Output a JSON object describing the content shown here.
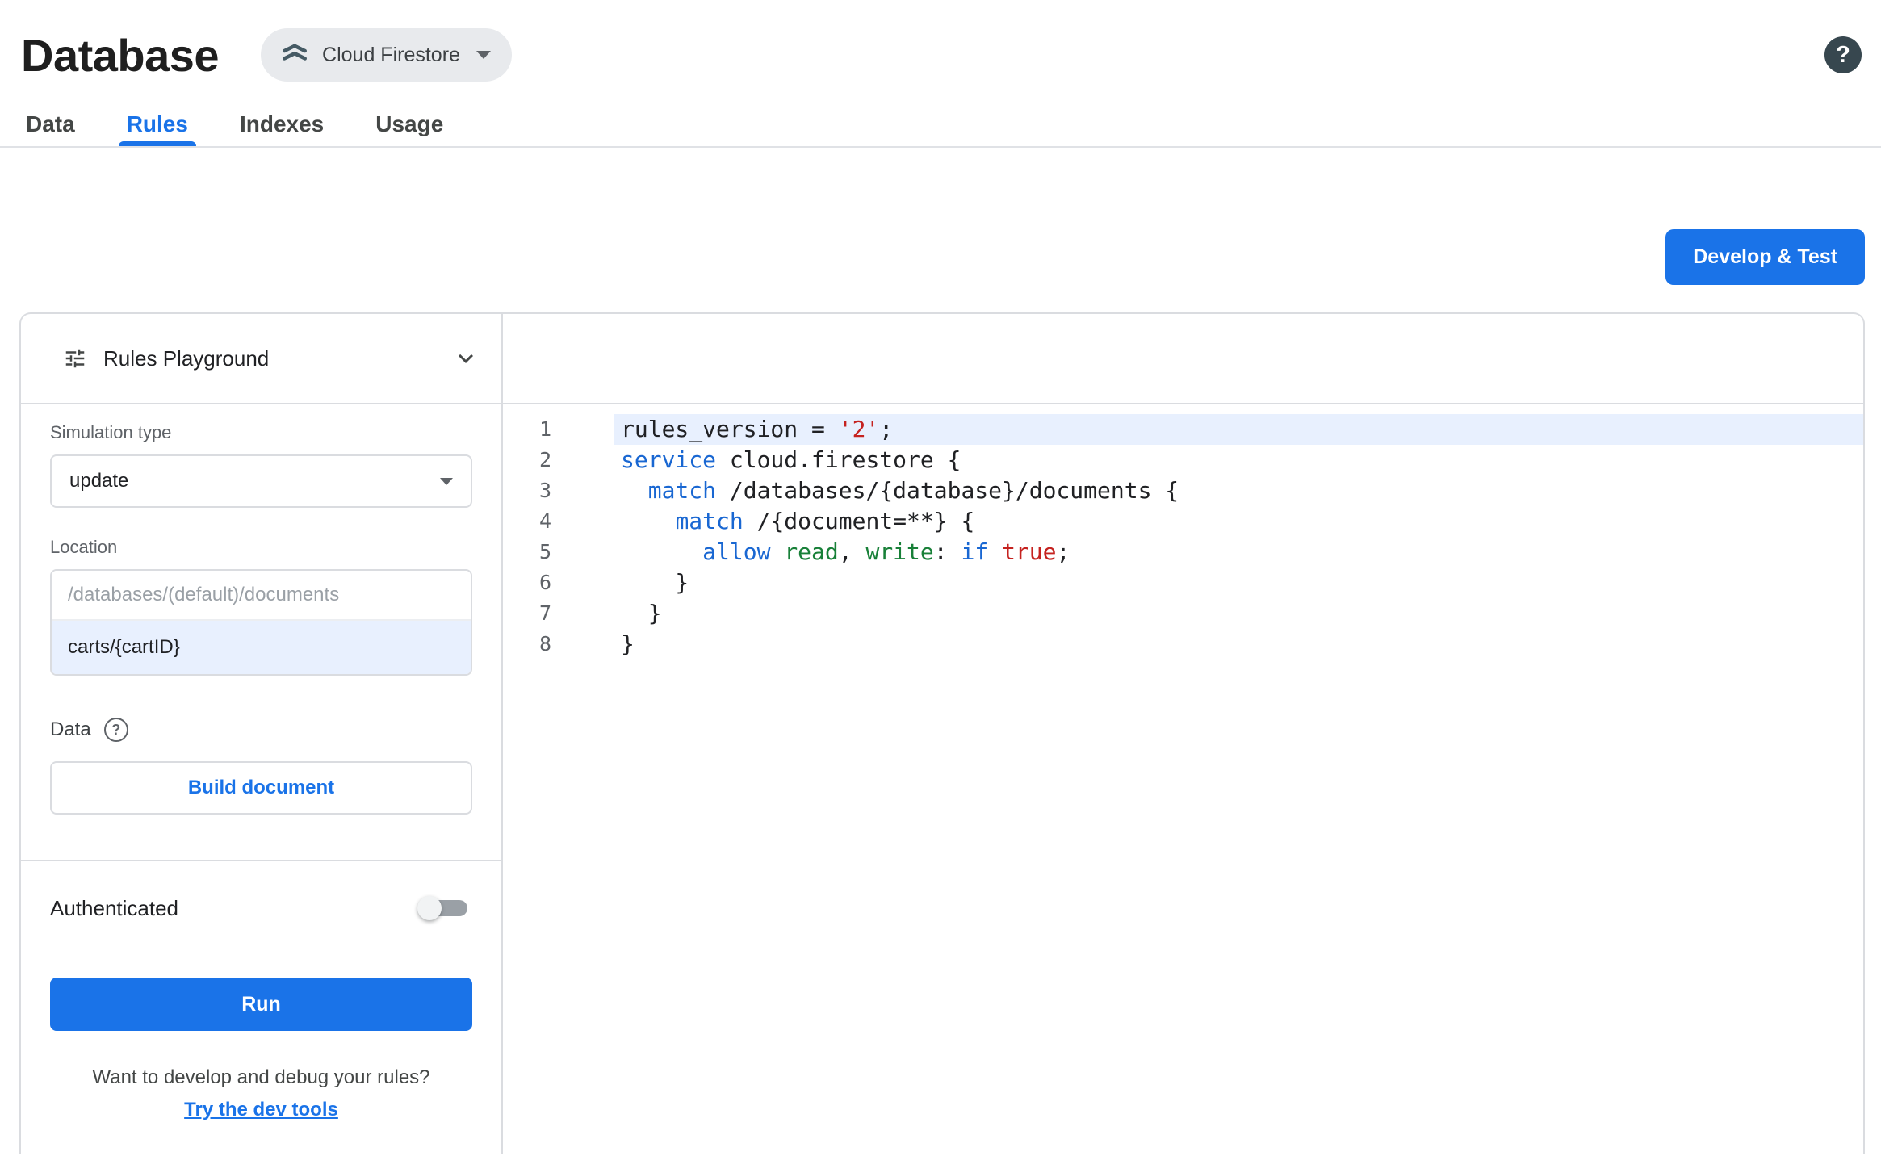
{
  "header": {
    "title": "Database",
    "product_chip": {
      "label": "Cloud Firestore"
    },
    "help_glyph": "?"
  },
  "tabs": [
    {
      "label": "Data",
      "active": false
    },
    {
      "label": "Rules",
      "active": true
    },
    {
      "label": "Indexes",
      "active": false
    },
    {
      "label": "Usage",
      "active": false
    }
  ],
  "actions": {
    "develop_test_label": "Develop & Test"
  },
  "playground": {
    "title": "Rules Playground",
    "simulation_type": {
      "label": "Simulation type",
      "value": "update"
    },
    "location": {
      "label": "Location",
      "placeholder": "/databases/(default)/documents",
      "value": "carts/{cartID}"
    },
    "data_section": {
      "label": "Data",
      "help_glyph": "?",
      "build_button": "Build document"
    },
    "authenticated": {
      "label": "Authenticated",
      "enabled": false
    },
    "run_button": "Run",
    "footer": {
      "text": "Want to develop and debug your rules?",
      "link": "Try the dev tools"
    }
  },
  "editor": {
    "lines": [
      {
        "number": 1,
        "highlighted": true,
        "tokens": [
          {
            "type": "plain",
            "text": "rules_version = "
          },
          {
            "type": "string",
            "text": "'2'"
          },
          {
            "type": "plain",
            "text": ";"
          }
        ]
      },
      {
        "number": 2,
        "highlighted": false,
        "tokens": [
          {
            "type": "keyword",
            "text": "service"
          },
          {
            "type": "plain",
            "text": " cloud.firestore {"
          }
        ]
      },
      {
        "number": 3,
        "highlighted": false,
        "tokens": [
          {
            "type": "plain",
            "text": "  "
          },
          {
            "type": "keyword",
            "text": "match"
          },
          {
            "type": "plain",
            "text": " /databases/{database}/documents {"
          }
        ]
      },
      {
        "number": 4,
        "highlighted": false,
        "tokens": [
          {
            "type": "plain",
            "text": "    "
          },
          {
            "type": "keyword",
            "text": "match"
          },
          {
            "type": "plain",
            "text": " /{document=**} {"
          }
        ]
      },
      {
        "number": 5,
        "highlighted": false,
        "tokens": [
          {
            "type": "plain",
            "text": "      "
          },
          {
            "type": "keyword",
            "text": "allow"
          },
          {
            "type": "plain",
            "text": " "
          },
          {
            "type": "builtin",
            "text": "read"
          },
          {
            "type": "plain",
            "text": ", "
          },
          {
            "type": "builtin",
            "text": "write"
          },
          {
            "type": "plain",
            "text": ": "
          },
          {
            "type": "keyword",
            "text": "if"
          },
          {
            "type": "plain",
            "text": " "
          },
          {
            "type": "string",
            "text": "true"
          },
          {
            "type": "plain",
            "text": ";"
          }
        ]
      },
      {
        "number": 6,
        "highlighted": false,
        "tokens": [
          {
            "type": "plain",
            "text": "    }"
          }
        ]
      },
      {
        "number": 7,
        "highlighted": false,
        "tokens": [
          {
            "type": "plain",
            "text": "  }"
          }
        ]
      },
      {
        "number": 8,
        "highlighted": false,
        "tokens": [
          {
            "type": "plain",
            "text": "}"
          }
        ]
      }
    ]
  },
  "colors": {
    "accent": "#1a73e8",
    "keyword": "#1967d2",
    "string": "#c5221f",
    "builtin": "#188038",
    "line_highlight": "#e8f0fe",
    "border": "#dadce0"
  }
}
